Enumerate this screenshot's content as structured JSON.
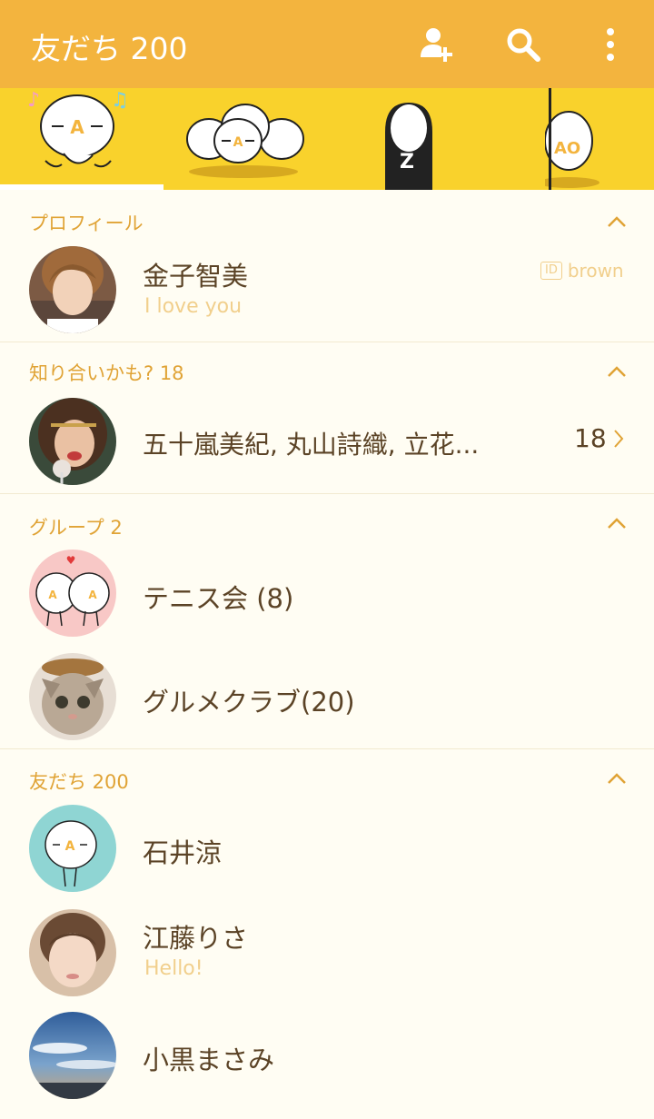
{
  "header": {
    "title": "友だち 200",
    "icons": [
      "add-friend-icon",
      "search-icon",
      "more-icon"
    ],
    "color": "#f3b43e"
  },
  "tabs": {
    "background": "#f9d22c",
    "items": [
      {
        "label": "A"
      },
      {
        "label": "A"
      },
      {
        "label": "Z"
      },
      {
        "label": "AO"
      }
    ]
  },
  "profile": {
    "section_title": "プロフィール",
    "name": "金子智美",
    "status": "I love you",
    "id_badge": "ID",
    "id_value": "brown"
  },
  "recommend": {
    "section_title": "知り合いかも? 18",
    "names": "五十嵐美紀, 丸山詩織, 立花...",
    "count": "18"
  },
  "groups": {
    "section_title": "グループ  2",
    "items": [
      {
        "name": "テニス会 (8)"
      },
      {
        "name": "グルメクラブ(20)"
      }
    ]
  },
  "friends": {
    "section_title": "友だち 200",
    "items": [
      {
        "name": "石井涼",
        "status": ""
      },
      {
        "name": "江藤りさ",
        "status": "Hello!"
      },
      {
        "name": "小黒まさみ",
        "status": ""
      }
    ]
  }
}
